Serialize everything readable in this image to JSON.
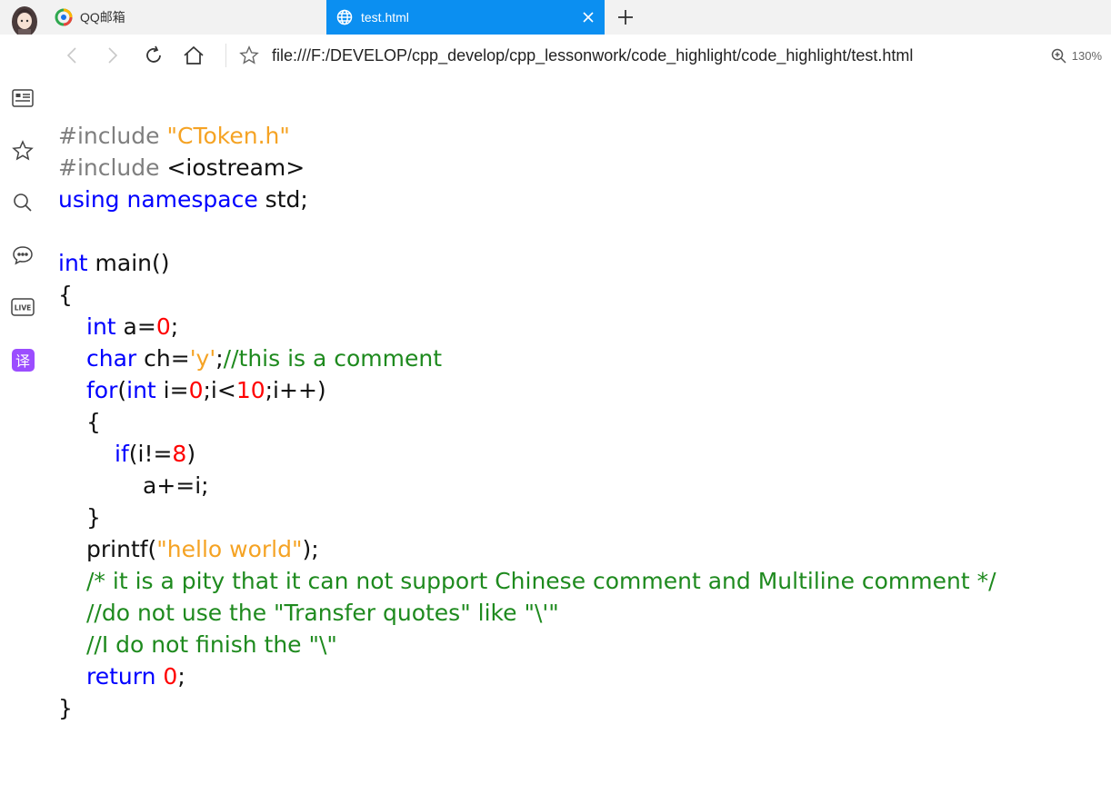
{
  "tabs": [
    {
      "title": "QQ邮箱",
      "active": false,
      "icon": "qq-mail-icon"
    },
    {
      "title": "test.html",
      "active": true,
      "icon": "globe-icon"
    }
  ],
  "toolbar": {
    "url": "file:///F:/DEVELOP/cpp_develop/cpp_lessonwork/code_highlight/code_highlight/test.html",
    "zoom": "130%"
  },
  "sidebar": {
    "items": [
      "news-icon",
      "favorites-star-icon",
      "search-icon",
      "chat-icon",
      "live-icon",
      "translate-icon"
    ],
    "translate_glyph": "译",
    "live_label": "LIVE"
  },
  "colors": {
    "accent": "#0b8ff1",
    "keyword": "#0000ff",
    "string": "#f5a324",
    "number": "#ff0000",
    "comment": "#1e8a1e",
    "preprocessor": "#7f7f7f"
  },
  "code": {
    "l1": {
      "pp": "#include",
      "str": "\"CToken.h\""
    },
    "l2": {
      "pp": "#include",
      "rest": " <iostream>"
    },
    "l3": {
      "kw1": "using",
      "kw2": "namespace",
      "rest": " std;"
    },
    "l5": {
      "kw": "int",
      "rest": " main()"
    },
    "l6": "{",
    "l7": {
      "kw": "int",
      "a": " a=",
      "num": "0",
      "end": ";"
    },
    "l8": {
      "kw": "char",
      "a": " ch=",
      "str": "'y'",
      "b": ";",
      "cm": "//this is a comment"
    },
    "l9": {
      "kw1": "for",
      "a": "(",
      "kw2": "int",
      "b": " i=",
      "n1": "0",
      "c": ";i<",
      "n2": "10",
      "d": ";i++)"
    },
    "l10": "{",
    "l11": {
      "kw": "if",
      "a": "(i!=",
      "num": "8",
      "b": ")"
    },
    "l12": "a+=i;",
    "l13": "}",
    "l14": {
      "a": "printf(",
      "str": "\"hello world\"",
      "b": ");"
    },
    "l15": "/* it is a pity that it can not support Chinese comment and Multiline comment */",
    "l16": "//do not use the \"Transfer quotes\" like \"\\'\"",
    "l17": "//I do not finish the \"\\\"",
    "l18": {
      "kw": "return",
      "num": "0",
      "end": ";"
    },
    "l19": "}"
  }
}
